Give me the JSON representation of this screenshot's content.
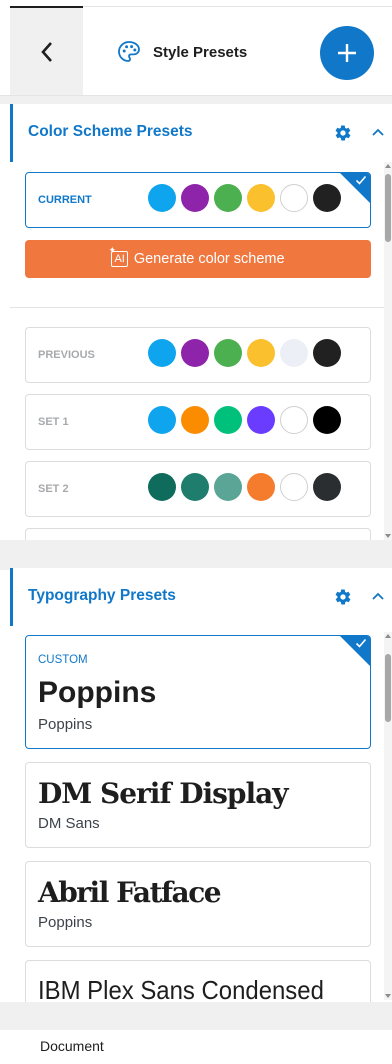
{
  "header": {
    "title": "Style Presets"
  },
  "color_section": {
    "title": "Color Scheme Presets",
    "presets": [
      {
        "label": "CURRENT",
        "colors": [
          "#0ea5ee",
          "#8e24aa",
          "#4caf50",
          "#fbc02d",
          "#ffffff",
          "#212121"
        ]
      },
      {
        "label": "PREVIOUS",
        "colors": [
          "#0ea5ee",
          "#8e24aa",
          "#4caf50",
          "#fbc02d",
          "#eceff5",
          "#212121"
        ]
      },
      {
        "label": "SET 1",
        "colors": [
          "#0ea5ee",
          "#fb8c00",
          "#00c17c",
          "#6a3cff",
          "#ffffff",
          "#000000"
        ]
      },
      {
        "label": "SET 2",
        "colors": [
          "#0f6b5c",
          "#1e7d6c",
          "#5aa596",
          "#f57c2d",
          "#ffffff",
          "#2a2e30"
        ]
      }
    ],
    "generate_label": "Generate color scheme",
    "generate_prefix": "AI"
  },
  "typography_section": {
    "title": "Typography Presets",
    "presets": [
      {
        "label": "CUSTOM",
        "heading": "Poppins",
        "body": "Poppins"
      },
      {
        "heading": "DM Serif Display",
        "body": "DM Sans"
      },
      {
        "heading": "Abril Fatface",
        "body": "Poppins"
      },
      {
        "heading": "IBM Plex Sans Condensed",
        "body": ""
      }
    ]
  },
  "footer": {
    "label": "Document"
  },
  "colors": {
    "accent": "#1178c9",
    "generate_button": "#f0783f"
  }
}
